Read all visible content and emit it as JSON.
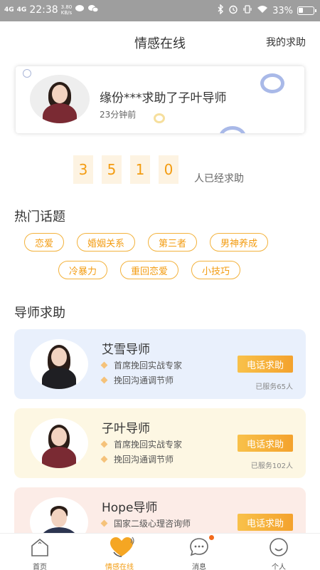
{
  "status_bar": {
    "signal1": "4G",
    "signal2": "4G",
    "time": "22:38",
    "speed_value": "3.80",
    "speed_unit": "KB/s",
    "battery_percent": "33%",
    "battery_level": 0.33
  },
  "header": {
    "title": "情感在线",
    "right_link": "我的求助"
  },
  "notice": {
    "text": "缘份***求助了子叶导师",
    "time": "23分钟前"
  },
  "counter": {
    "digits": [
      "3",
      "5",
      "1",
      "0"
    ],
    "label": "人已经求助"
  },
  "hot_topics": {
    "title": "热门话题",
    "row1": [
      "恋爱",
      "婚姻关系",
      "第三者",
      "男神养成"
    ],
    "row2": [
      "冷暴力",
      "重回恋爱",
      "小技巧"
    ]
  },
  "mentors": {
    "title": "导师求助",
    "call_label": "电话求助",
    "items": [
      {
        "name": "艾雪导师",
        "features": [
          "首席挽回实战专家",
          "挽回沟通调节师"
        ],
        "served": "已服务65人",
        "bg": "#e9f0fc"
      },
      {
        "name": "子叶导师",
        "features": [
          "首席挽回实战专家",
          "挽回沟通调节师"
        ],
        "served": "已服务102人",
        "bg": "#fdf7e3"
      },
      {
        "name": "Hope导师",
        "features": [
          "国家二级心理咨询师"
        ],
        "served": "",
        "bg": "#fcece7"
      }
    ]
  },
  "tabs": [
    {
      "label": "首页",
      "icon": "home-icon"
    },
    {
      "label": "情感在线",
      "icon": "heart-icon"
    },
    {
      "label": "消息",
      "icon": "message-icon"
    },
    {
      "label": "个人",
      "icon": "profile-icon"
    }
  ],
  "colors": {
    "accent": "#f39c12",
    "tag_border": "#f3b23c",
    "button_gradient_start": "#f8c14a",
    "button_gradient_end": "#f4a22d",
    "status_bar": "#9e9e9e"
  }
}
